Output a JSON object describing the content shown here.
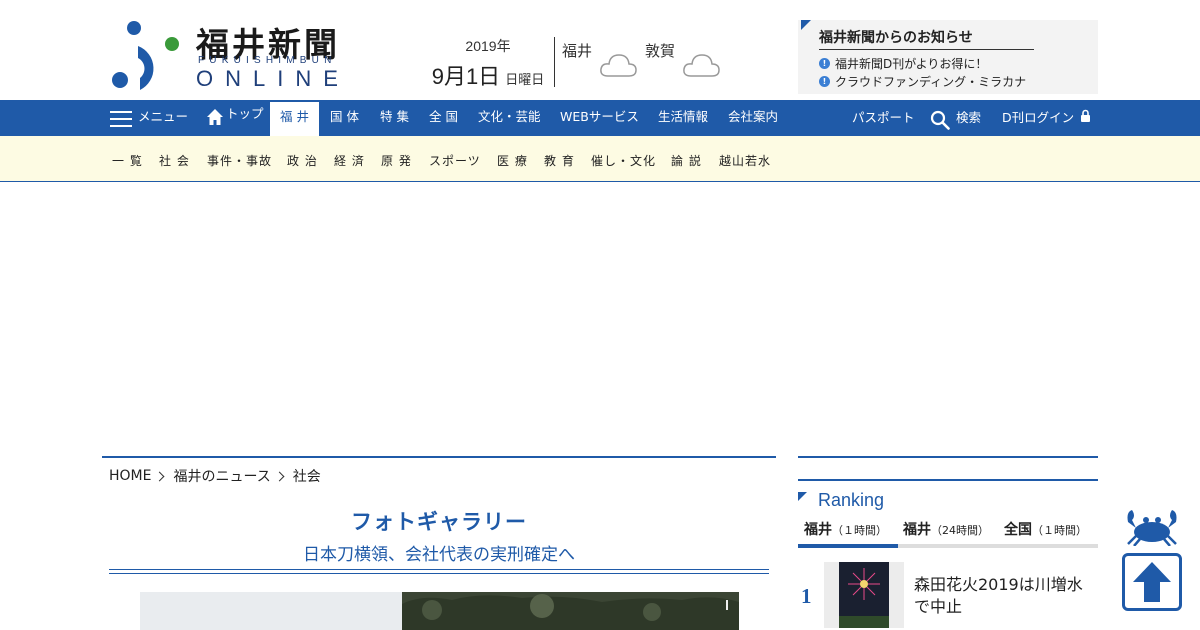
{
  "logo": {
    "title": "福井新聞",
    "romaji": "FUKUISHIMBUN",
    "online": "ONLINE"
  },
  "date": {
    "year": "2019年",
    "month_day": "9月1日",
    "day_of_week": "日曜日"
  },
  "weather": [
    {
      "city": "福井",
      "icon": "cloud-icon"
    },
    {
      "city": "敦賀",
      "icon": "cloud-icon"
    }
  ],
  "notice": {
    "title": "福井新聞からのお知らせ",
    "items": [
      "福井新聞D刊がよりお得に！",
      "クラウドファンディング・ミラカナ"
    ]
  },
  "nav": {
    "menu": "メニュー",
    "top": "トップ",
    "items": [
      "福 井",
      "国 体",
      "特 集",
      "全 国",
      "文化・芸能",
      "WEBサービス",
      "生活情報",
      "会社案内"
    ],
    "active": "福 井",
    "passport": "パスポート",
    "search": "検索",
    "login": "D刊ログイン"
  },
  "subnav": {
    "items": [
      "一 覧",
      "社 会",
      "事件・事故",
      "政 治",
      "経 済",
      "原 発",
      "スポーツ",
      "医 療",
      "教 育",
      "催し・文化",
      "論 説",
      "越山若水"
    ]
  },
  "breadcrumb": [
    "HOME",
    "福井のニュース",
    "社会"
  ],
  "gallery": {
    "title": "フォトギャラリー",
    "subtitle": "日本刀横領、会社代表の実刑確定へ"
  },
  "ranking": {
    "heading": "Ranking",
    "tabs": [
      {
        "label": "福井",
        "period": "（１時間）"
      },
      {
        "label": "福井",
        "period": "（24時間）"
      },
      {
        "label": "全国",
        "period": "（１時間）"
      }
    ],
    "items": [
      {
        "rank": "1",
        "title": "森田花火2019は川増水で中止"
      }
    ]
  },
  "colors": {
    "brand_blue": "#1f5aa8",
    "subnav_bg": "#fdfbe3",
    "logo_green": "#4caf50"
  }
}
